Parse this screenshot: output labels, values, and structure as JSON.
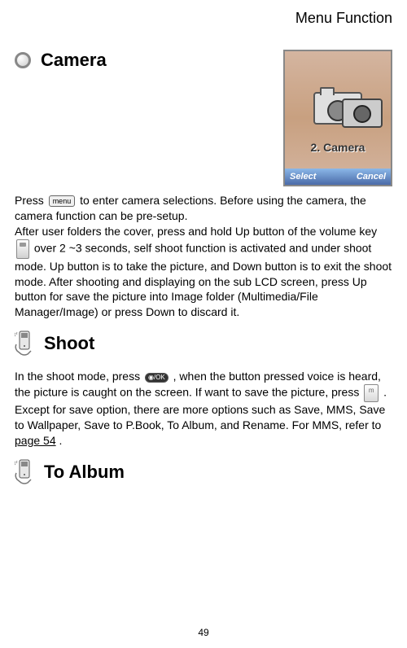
{
  "header": {
    "title": "Menu Function"
  },
  "phone": {
    "menu_label": "2. Camera",
    "softkey_left": "Select",
    "softkey_right": "Cancel"
  },
  "sections": {
    "camera": {
      "heading": "Camera",
      "para_1a": "Press ",
      "para_1b": " to enter camera selections. Before using the camera, the camera function can be pre-setup.",
      "para_2a": "After user folders the cover, press and hold Up button of the volume key ",
      "para_2b": " over 2 ~3 seconds, self shoot function is activated and under shoot mode.    Up button is to take the picture, and Down button is to exit the shoot mode.   After shooting and displaying on the sub LCD screen, press Up button for save the picture into Image folder (Multimedia/File Manager/Image) or press Down to discard it."
    },
    "shoot": {
      "heading": "Shoot",
      "para_1a": "In the shoot mode, press ",
      "para_1b": ", when the button pressed voice is heard, the picture is caught on the screen.   If want to save the picture, press ",
      "para_1c": ".   Except for save option, there are more options such as Save, MMS, Save to Wallpaper, Save to P.Book, To Album, and Rename. For MMS, refer to ",
      "link_text": "page 54",
      "para_1d": "."
    },
    "toalbum": {
      "heading": "To Album"
    }
  },
  "icons": {
    "menu_key": "menu",
    "ok_key": "◉/OK",
    "m_key": "m"
  },
  "page_number": "49"
}
